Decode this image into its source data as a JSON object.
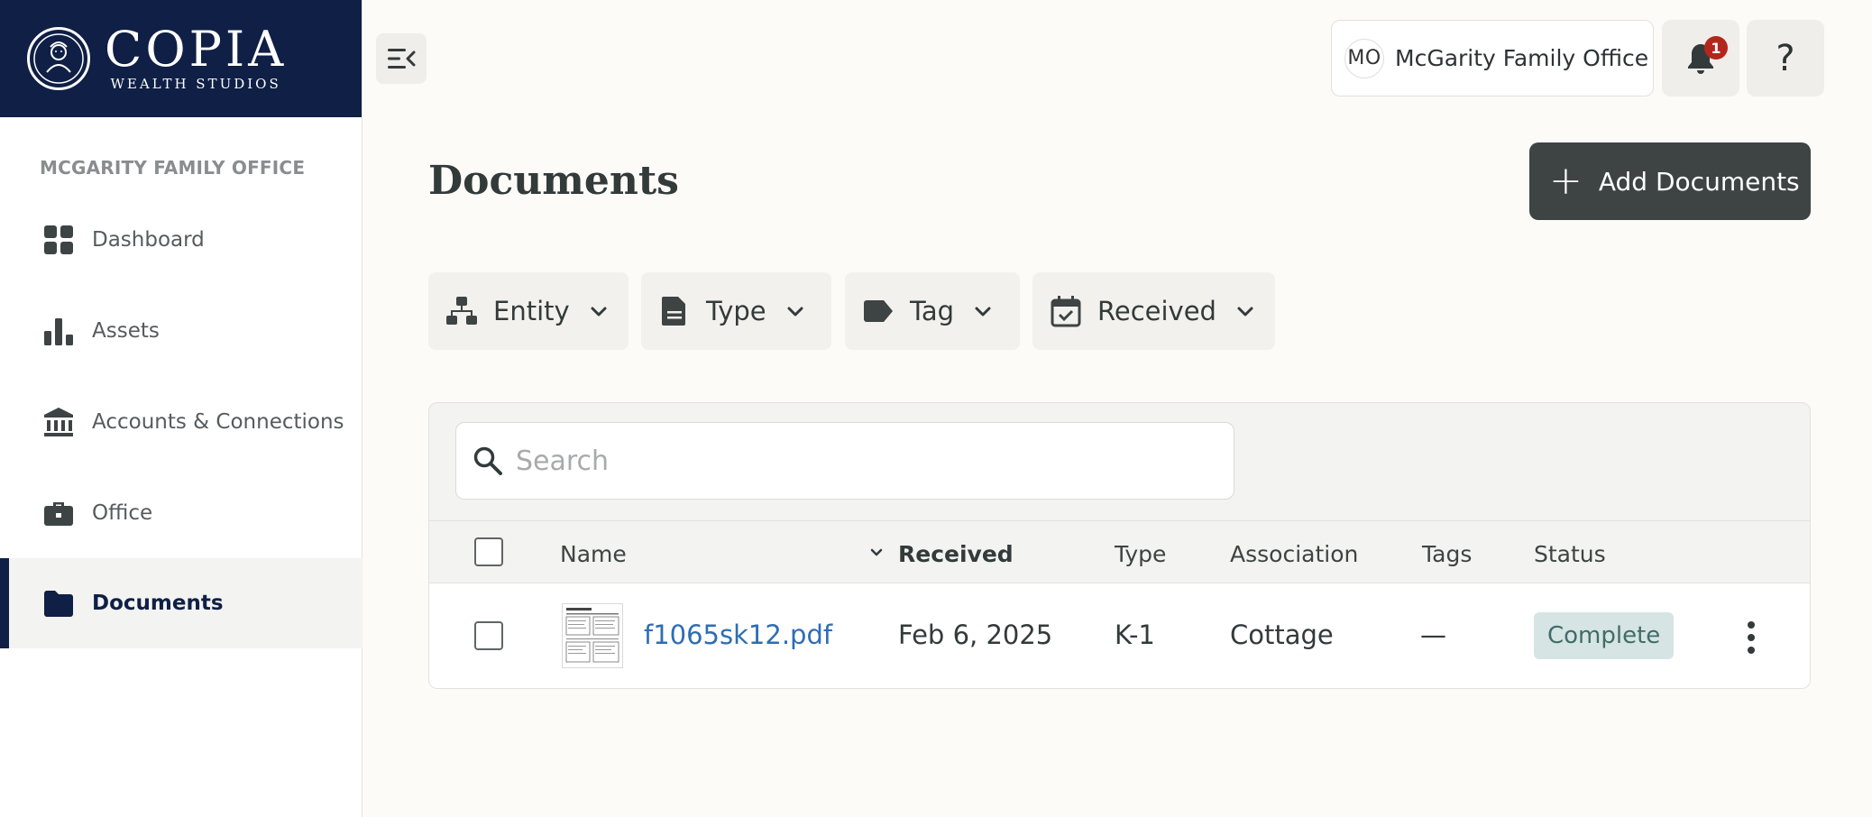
{
  "brand": {
    "name": "COPIA",
    "subtitle": "WEALTH STUDIOS"
  },
  "sidebar": {
    "org_label": "MCGARITY FAMILY OFFICE",
    "items": [
      {
        "label": "Dashboard",
        "icon": "grid-icon"
      },
      {
        "label": "Assets",
        "icon": "bar-chart-icon"
      },
      {
        "label": "Accounts & Connections",
        "icon": "bank-icon"
      },
      {
        "label": "Office",
        "icon": "briefcase-icon"
      },
      {
        "label": "Documents",
        "icon": "folder-icon",
        "active": true
      }
    ]
  },
  "header": {
    "avatar_initials": "MO",
    "org_name": "McGarity Family Office",
    "notification_count": "1",
    "help_label": "?"
  },
  "main": {
    "title": "Documents",
    "add_button_label": "Add Documents",
    "filters": [
      {
        "label": "Entity",
        "icon": "hierarchy-icon"
      },
      {
        "label": "Type",
        "icon": "document-icon"
      },
      {
        "label": "Tag",
        "icon": "tag-icon"
      },
      {
        "label": "Received",
        "icon": "calendar-check-icon"
      }
    ],
    "search": {
      "placeholder": "Search"
    },
    "table": {
      "columns": {
        "name": "Name",
        "received": "Received",
        "type": "Type",
        "association": "Association",
        "tags": "Tags",
        "status": "Status"
      },
      "rows": [
        {
          "name": "f1065sk12.pdf",
          "received": "Feb 6, 2025",
          "type": "K-1",
          "association": "Cottage",
          "tags": "—",
          "status": "Complete"
        }
      ]
    }
  },
  "colors": {
    "brand_navy": "#0f1f45",
    "button_dark": "#3d4443",
    "link_blue": "#2e6db4",
    "status_complete_bg": "#d6e4e3",
    "badge_red": "#b3261e"
  }
}
